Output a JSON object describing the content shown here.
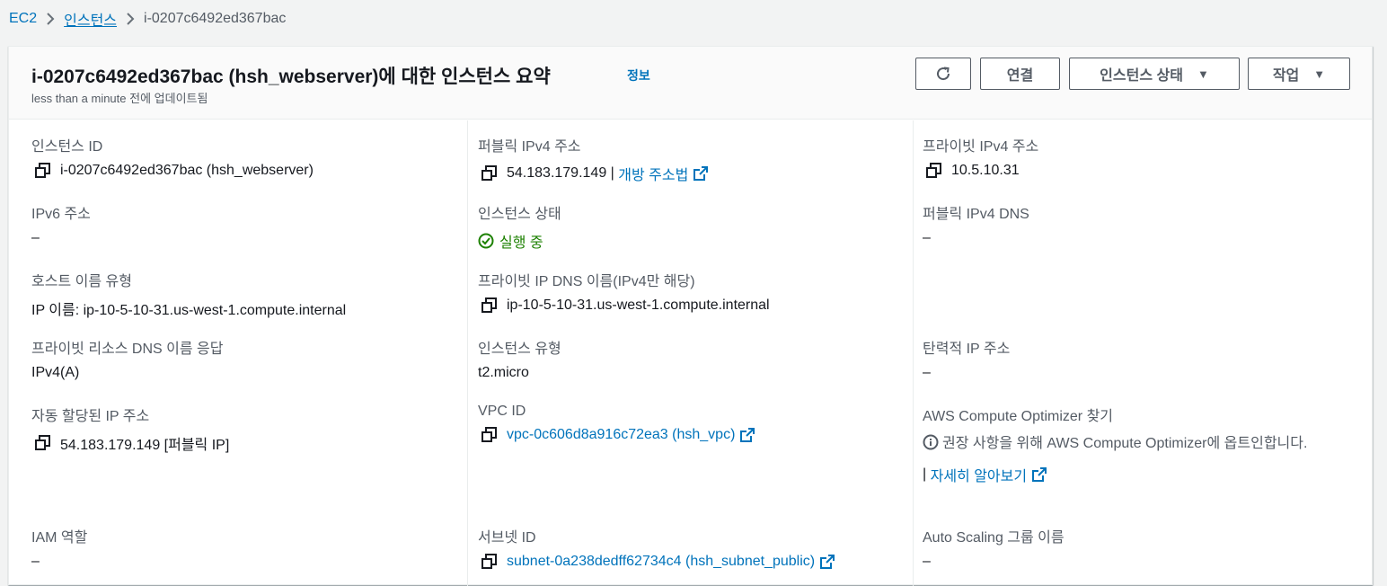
{
  "breadcrumb": {
    "root": "EC2",
    "instances": "인스턴스",
    "current": "i-0207c6492ed367bac"
  },
  "header": {
    "title": "i-0207c6492ed367bac (hsh_webserver)에 대한 인스턴스 요약",
    "info_link": "정보",
    "subtitle": "less than a minute 전에 업데이트됨",
    "refresh_icon": "refresh-icon",
    "connect_label": "연결",
    "instance_state_label": "인스턴스 상태",
    "actions_label": "작업"
  },
  "details": {
    "instance_id": {
      "label": "인스턴스 ID",
      "value": "i-0207c6492ed367bac (hsh_webserver)"
    },
    "public_ipv4": {
      "label": "퍼블릭 IPv4 주소",
      "value": "54.183.179.149",
      "separator": " | ",
      "link": "개방 주소법"
    },
    "private_ipv4": {
      "label": "프라이빗 IPv4 주소",
      "value": "10.5.10.31"
    },
    "ipv6": {
      "label": "IPv6 주소",
      "value": "–"
    },
    "instance_state": {
      "label": "인스턴스 상태",
      "value": "실행 중"
    },
    "public_dns": {
      "label": "퍼블릭 IPv4 DNS",
      "value": "–"
    },
    "hostname_type": {
      "label": "호스트 이름 유형",
      "value": "IP 이름: ip-10-5-10-31.us-west-1.compute.internal"
    },
    "private_dns": {
      "label": "프라이빗 IP DNS 이름(IPv4만 해당)",
      "value": "ip-10-5-10-31.us-west-1.compute.internal"
    },
    "resource_dns": {
      "label": "프라이빗 리소스 DNS 이름 응답",
      "value": "IPv4(A)"
    },
    "instance_type": {
      "label": "인스턴스 유형",
      "value": "t2.micro"
    },
    "elastic_ip": {
      "label": "탄력적 IP 주소",
      "value": "–"
    },
    "auto_ip": {
      "label": "자동 할당된 IP 주소",
      "value": "54.183.179.149 [퍼블릭 IP]"
    },
    "vpc_id": {
      "label": "VPC ID",
      "value": "vpc-0c606d8a916c72ea3 (hsh_vpc)"
    },
    "optimizer": {
      "label": "AWS Compute Optimizer 찾기",
      "text": "권장 사항을 위해 AWS Compute Optimizer에 옵트인합니다.",
      "learn_prefix": "| ",
      "learn_more": "자세히 알아보기"
    },
    "iam_role": {
      "label": "IAM 역할",
      "value": "–"
    },
    "subnet_id": {
      "label": "서브넷 ID",
      "value": "subnet-0a238dedff62734c4 (hsh_subnet_public)"
    },
    "asg_name": {
      "label": "Auto Scaling 그룹 이름",
      "value": "–"
    }
  },
  "colors": {
    "link": "#0073bb",
    "running": "#1d8102",
    "label": "#545b64",
    "text": "#16191f"
  }
}
